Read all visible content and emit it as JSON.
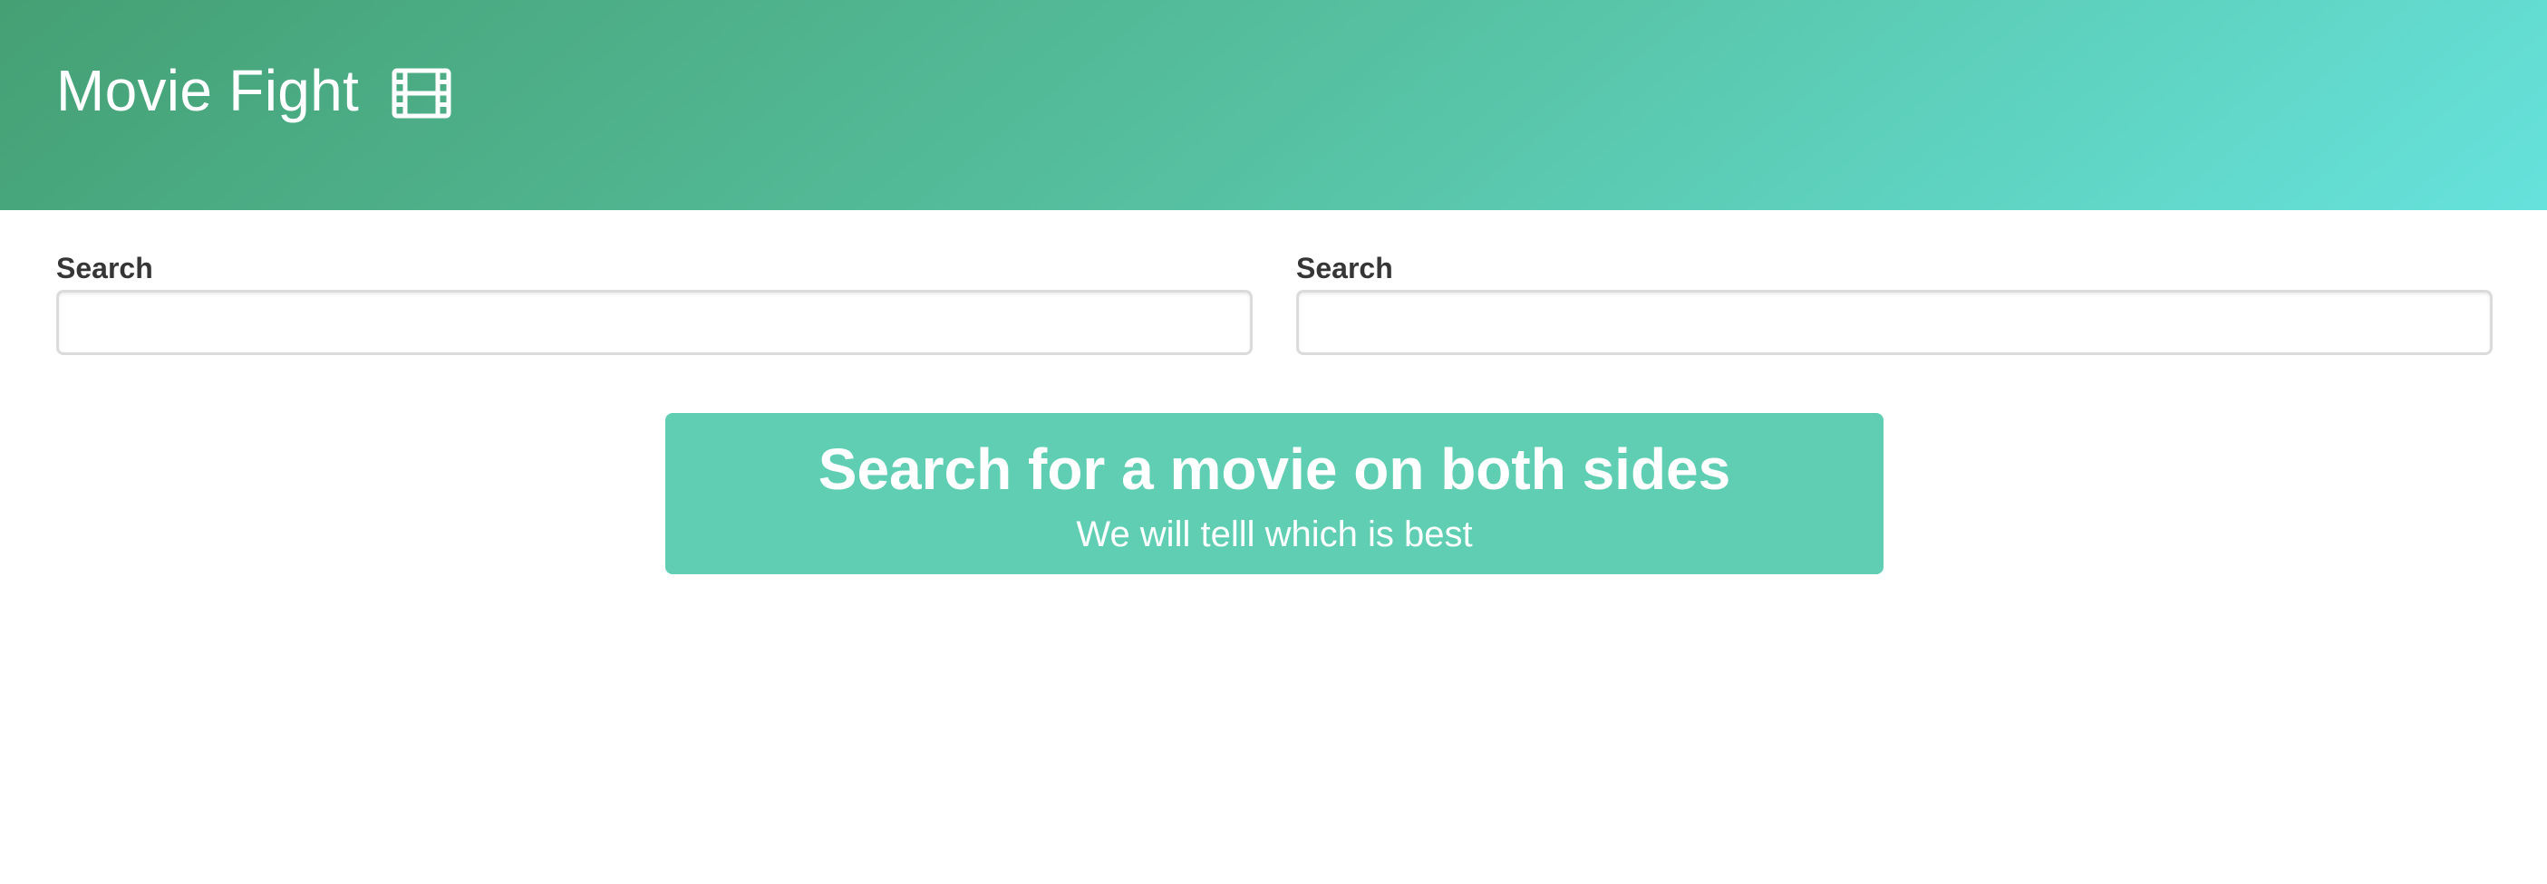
{
  "header": {
    "title": "Movie Fight",
    "icon": "film-icon",
    "gradient_start": "#45a074",
    "gradient_end": "#66e2dc"
  },
  "left_search": {
    "label": "Search",
    "value": "",
    "placeholder": ""
  },
  "right_search": {
    "label": "Search",
    "value": "",
    "placeholder": ""
  },
  "notice": {
    "title": "Search for a movie on both sides",
    "subtitle": "We will telll which is best",
    "color": "#5fceb3"
  }
}
